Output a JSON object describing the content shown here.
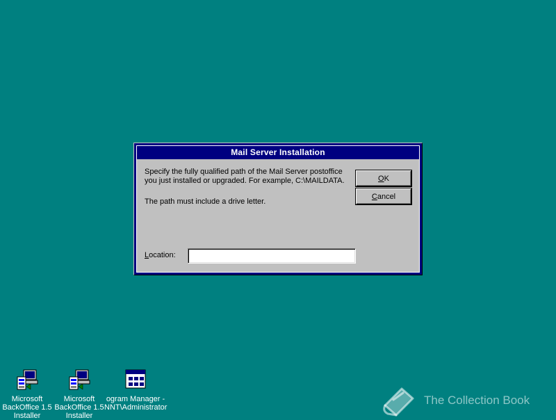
{
  "dialog": {
    "title": "Mail Server Installation",
    "message_line1": "Specify the fully qualified path of the Mail Server postoffice you just installed or upgraded. For example, C:\\MAILDATA.",
    "message_line2": "The path must include a drive letter.",
    "ok_accel": "O",
    "ok_rest": "K",
    "cancel_accel": "C",
    "cancel_rest": "ancel",
    "location_accel": "L",
    "location_rest": "ocation:",
    "location_value": ""
  },
  "desktop_icons": [
    {
      "line1": "Microsoft",
      "line2": "BackOffice 1.5",
      "line3": "Installer",
      "icon": "computer-setup-icon"
    },
    {
      "line1": "Microsoft",
      "line2": "BackOffice 1.5",
      "line3": "Installer",
      "icon": "computer-setup-icon"
    },
    {
      "line1": "ogram Manager -",
      "line2": "NNT\\Administrator",
      "line3": "",
      "icon": "program-manager-icon"
    }
  ],
  "watermark": {
    "text": "The Collection Book",
    "icon": "book-icon"
  },
  "colors": {
    "desktop": "#008080",
    "dialog_title": "#000080",
    "dialog_face": "#c0c0c0"
  }
}
